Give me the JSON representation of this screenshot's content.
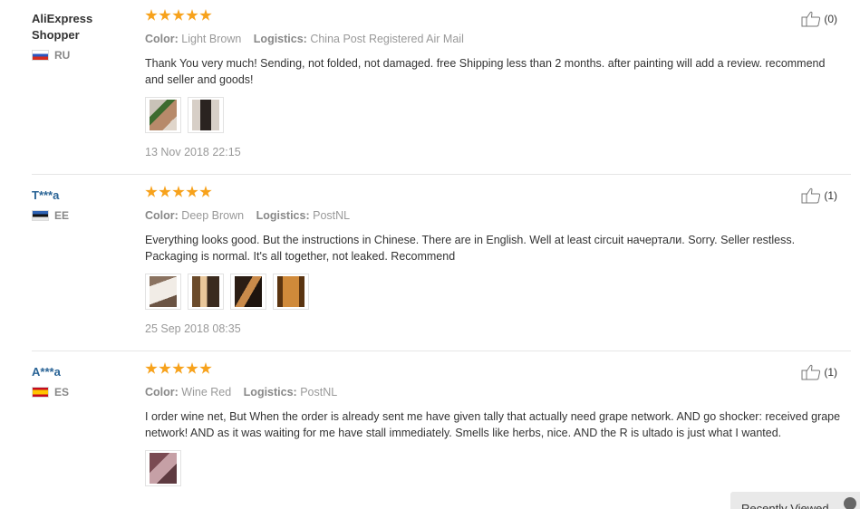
{
  "reviews": [
    {
      "buyer": "AliExpress Shopper",
      "country": "RU",
      "rating": 5,
      "color_label": "Color:",
      "color": "Light Brown",
      "logistics_label": "Logistics:",
      "logistics": "China Post Registered Air Mail",
      "text": "Thank You very much! Sending, not folded, not damaged. free Shipping less than 2 months. after painting will add a review. recommend and seller and goods!",
      "helpful": "(0)",
      "date": "13 Nov 2018 22:15",
      "photo_count": 2
    },
    {
      "buyer": "T***a",
      "country": "EE",
      "rating": 5,
      "color_label": "Color:",
      "color": "Deep Brown",
      "logistics_label": "Logistics:",
      "logistics": "PostNL",
      "text": "Everything looks good. But the instructions in Chinese. There are in English. Well at least circuit начертали. Sorry. Seller restless. Packaging is normal. It's all together, not leaked. Recommend",
      "helpful": "(1)",
      "date": "25 Sep 2018 08:35",
      "photo_count": 4
    },
    {
      "buyer": "A***a",
      "country": "ES",
      "rating": 5,
      "color_label": "Color:",
      "color": "Wine Red",
      "logistics_label": "Logistics:",
      "logistics": "PostNL",
      "text": "I order wine net, But When the order is already sent me have given tally that actually need grape network. AND go shocker: received grape network! AND as it was waiting for me have stall immediately. Smells like herbs, nice. AND the R is ultado is just what I wanted.",
      "helpful": "(1)",
      "photo_count": 1
    }
  ],
  "recently_viewed": "Recently Viewed",
  "colors": {
    "star": "#f7a21c",
    "masked_name": "#2a6496"
  }
}
